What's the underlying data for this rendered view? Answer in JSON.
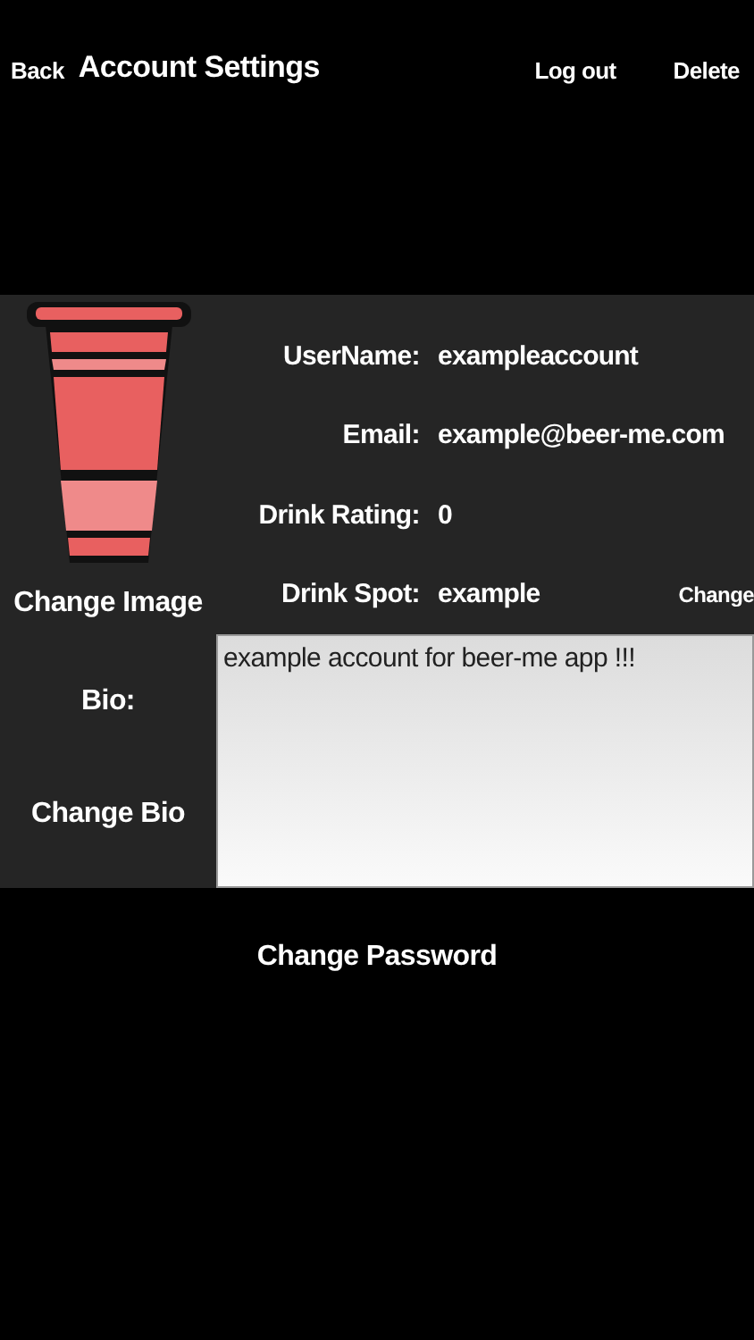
{
  "header": {
    "back": "Back",
    "title": "Account Settings",
    "logout": "Log out",
    "delete": "Delete"
  },
  "profile": {
    "change_image": "Change Image"
  },
  "fields": [
    {
      "label": "UserName:",
      "value": "exampleaccount"
    },
    {
      "label": "Email:",
      "value": "example@beer-me.com"
    },
    {
      "label": "Drink Rating:",
      "value": "0"
    },
    {
      "label": "Drink Spot:",
      "value": "example",
      "action": "Change"
    }
  ],
  "bio": {
    "label": "Bio:",
    "change": "Change Bio",
    "value": "example account for beer-me app !!!"
  },
  "change_password": "Change Password"
}
